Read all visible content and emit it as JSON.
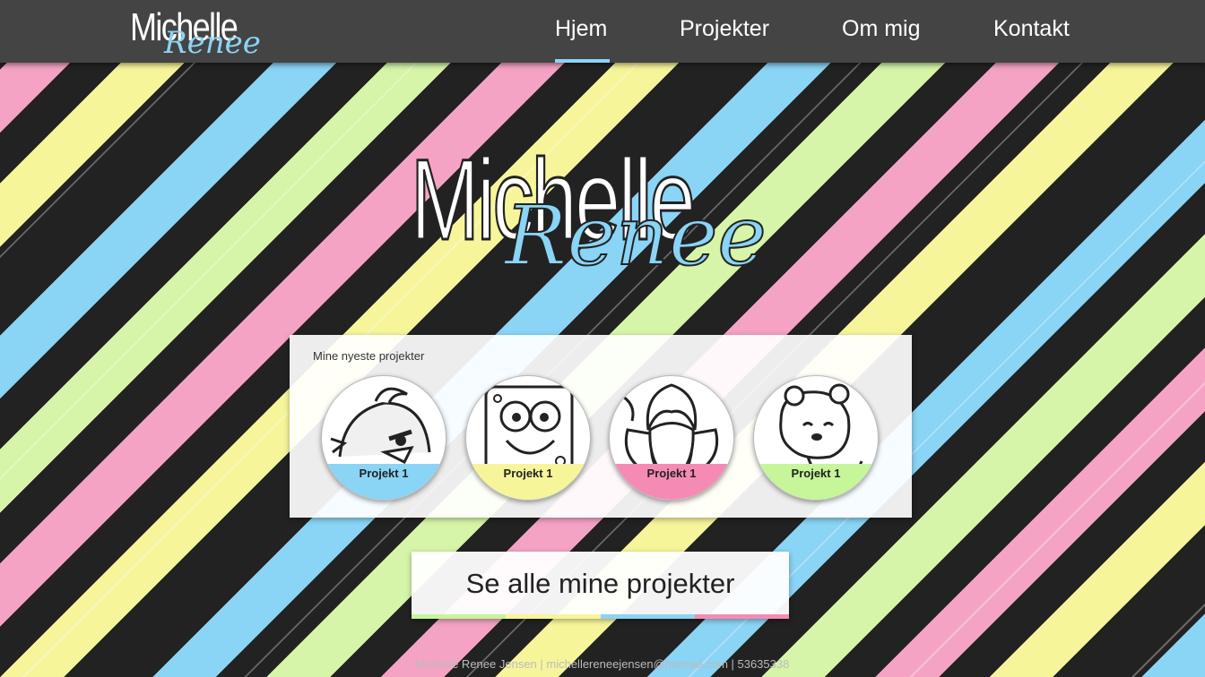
{
  "header": {
    "logo": {
      "line1": "Michelle",
      "line2": "Renee"
    },
    "nav": [
      {
        "label": "Hjem"
      },
      {
        "label": "Projekter"
      },
      {
        "label": "Om mig"
      },
      {
        "label": "Kontakt"
      }
    ]
  },
  "hero": {
    "line1": "Michelle",
    "line2": "Renee"
  },
  "projects": {
    "title": "Mine nyeste projekter",
    "items": [
      {
        "label": "Projekt 1",
        "color": "#8ad4f5",
        "icon": "angry-bird-icon"
      },
      {
        "label": "Projekt 1",
        "color": "#f7f59a",
        "icon": "spongebob-icon"
      },
      {
        "label": "Projekt 1",
        "color": "#f58bb4",
        "icon": "flower-icon"
      },
      {
        "label": "Projekt 1",
        "color": "#c6f59a",
        "icon": "pooh-bear-icon"
      }
    ]
  },
  "cta": {
    "label": "Se alle mine projekter"
  },
  "footer": {
    "text": "Michelle Renee Jensen | michellereneejensen@hotmail.com | 53635338"
  },
  "colors": {
    "blue": "#8ad4f5",
    "yellow": "#f7f59a",
    "pink": "#f58bb4",
    "green": "#c6f59a",
    "header": "#444444"
  }
}
